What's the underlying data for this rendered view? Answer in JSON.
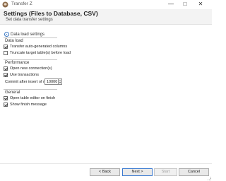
{
  "window": {
    "title": "Transfer Z",
    "minimize_glyph": "—",
    "maximize_glyph": "□",
    "close_glyph": "✕",
    "app_icon": "dbeaver-icon",
    "accent_color": "#3a78c4"
  },
  "header": {
    "title": "Settings (Files to Database, CSV)",
    "subtitle": "Set data transfer settings"
  },
  "settings_tab": {
    "label": "Data load settings",
    "icon": "settings-icon"
  },
  "groups": {
    "data_load": {
      "title": "Data load",
      "options": [
        {
          "label": "Transfer auto-generated columns",
          "checked": true
        },
        {
          "label": "Truncate target table(s) before load",
          "checked": false
        }
      ]
    },
    "performance": {
      "title": "Performance",
      "options": [
        {
          "label": "Open new connection(s)",
          "checked": true
        },
        {
          "label": "Use transactions",
          "checked": true
        }
      ],
      "commit_label": "Commit after insert of n",
      "commit_value": "10000"
    },
    "general": {
      "title": "General",
      "options": [
        {
          "label": "Open table editor on finish",
          "checked": true
        },
        {
          "label": "Show finish message",
          "checked": true
        }
      ]
    }
  },
  "footer": {
    "back_label": "< Back",
    "next_label": "Next >",
    "start_label": "Start",
    "cancel_label": "Cancel"
  }
}
